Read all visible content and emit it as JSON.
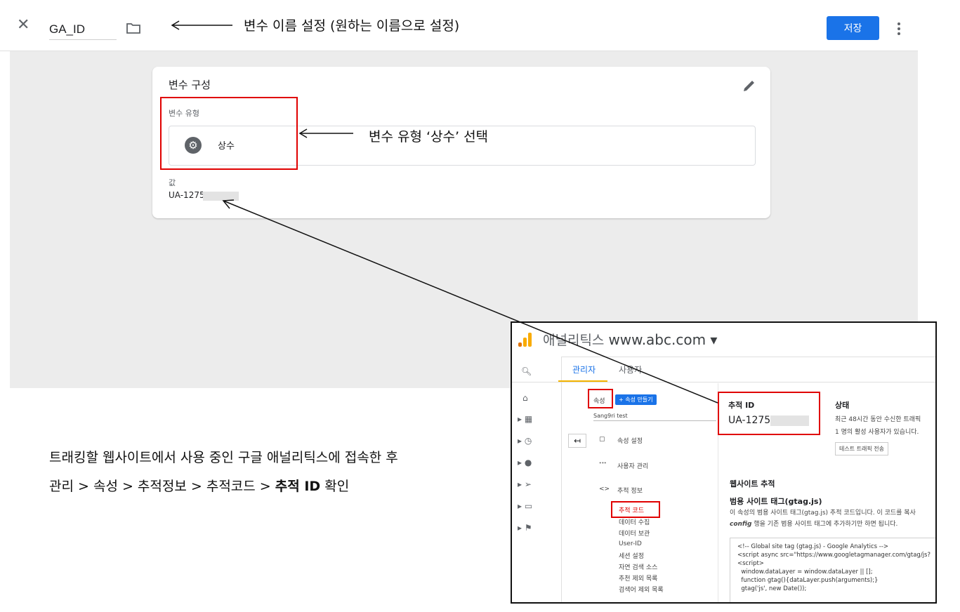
{
  "header": {
    "close_icon": "close-icon",
    "variable_name": "GA_ID",
    "folder_icon": "folder-icon",
    "note_name": "변수 이름 설정 (원하는 이름으로 설정)",
    "save_label": "저장",
    "more_icon": "more-vert-icon"
  },
  "config_card": {
    "title": "변수 구성",
    "edit_icon": "pencil-icon",
    "type_label": "변수 유형",
    "type_value": "상수",
    "type_icon": "gear-icon",
    "note_type": "변수 유형 ‘상수’ 선택",
    "value_label": "값",
    "value_text": "UA-1275"
  },
  "instructions": {
    "line1": "트래킹할 웹사이트에서 사용 중인 구글 애널리틱스에 접속한 후",
    "line2_prefix": "관리 > 속성 > 추적정보 > 추적코드 > ",
    "line2_bold": "추적 ID",
    "line2_suffix": " 확인"
  },
  "ga_inset": {
    "app_name": "애널리틱스",
    "site": "www.abc.com ▾",
    "tabs": [
      "관리자",
      "사용자"
    ],
    "property_label": "속성",
    "create_property": "+ 속성 만들기",
    "property_select": "Sang9ri test",
    "menu": [
      "속성 설정",
      "사용자 관리",
      "추적 정보"
    ],
    "submenu": [
      "추적 코드",
      "데이터 수집",
      "데이터 보관",
      "User-ID",
      "세션 설정",
      "자연 검색 소스",
      "추천 제외 목록",
      "검색어 제외 목록"
    ],
    "tracking_id_label": "추적 ID",
    "tracking_id_value": "UA-1275",
    "status_label": "상태",
    "status_line1": "최근 48시간 동안 수신한 트래픽",
    "status_line2": "1 명의 활성 사용자가 있습니다.",
    "test_traffic_button": "테스트 트래픽 전송",
    "website_tracking": "웹사이트 추적",
    "gtag_title": "범용 사이트 태그(gtag.js)",
    "gtag_desc1": "이 속성의 범용 사이트 태그(gtag.js) 추적 코드입니다. 이 코드를 복사",
    "gtag_desc2_bold": "config",
    "gtag_desc2": " 행을 기존 범용 사이트 태그에 추가하기만 하면 됩니다.",
    "code_lines": [
      "<!-- Global site tag (gtag.js) - Google Analytics -->",
      "<script async src=\"https://www.googletagmanager.com/gtag/js?",
      "<script>",
      "  window.dataLayer = window.dataLayer || [];",
      "  function gtag(){dataLayer.push(arguments);}",
      "  gtag('js', new Date());"
    ]
  },
  "colors": {
    "accent": "#1a73e8",
    "highlight": "#e00000",
    "workspace": "#ececec"
  }
}
